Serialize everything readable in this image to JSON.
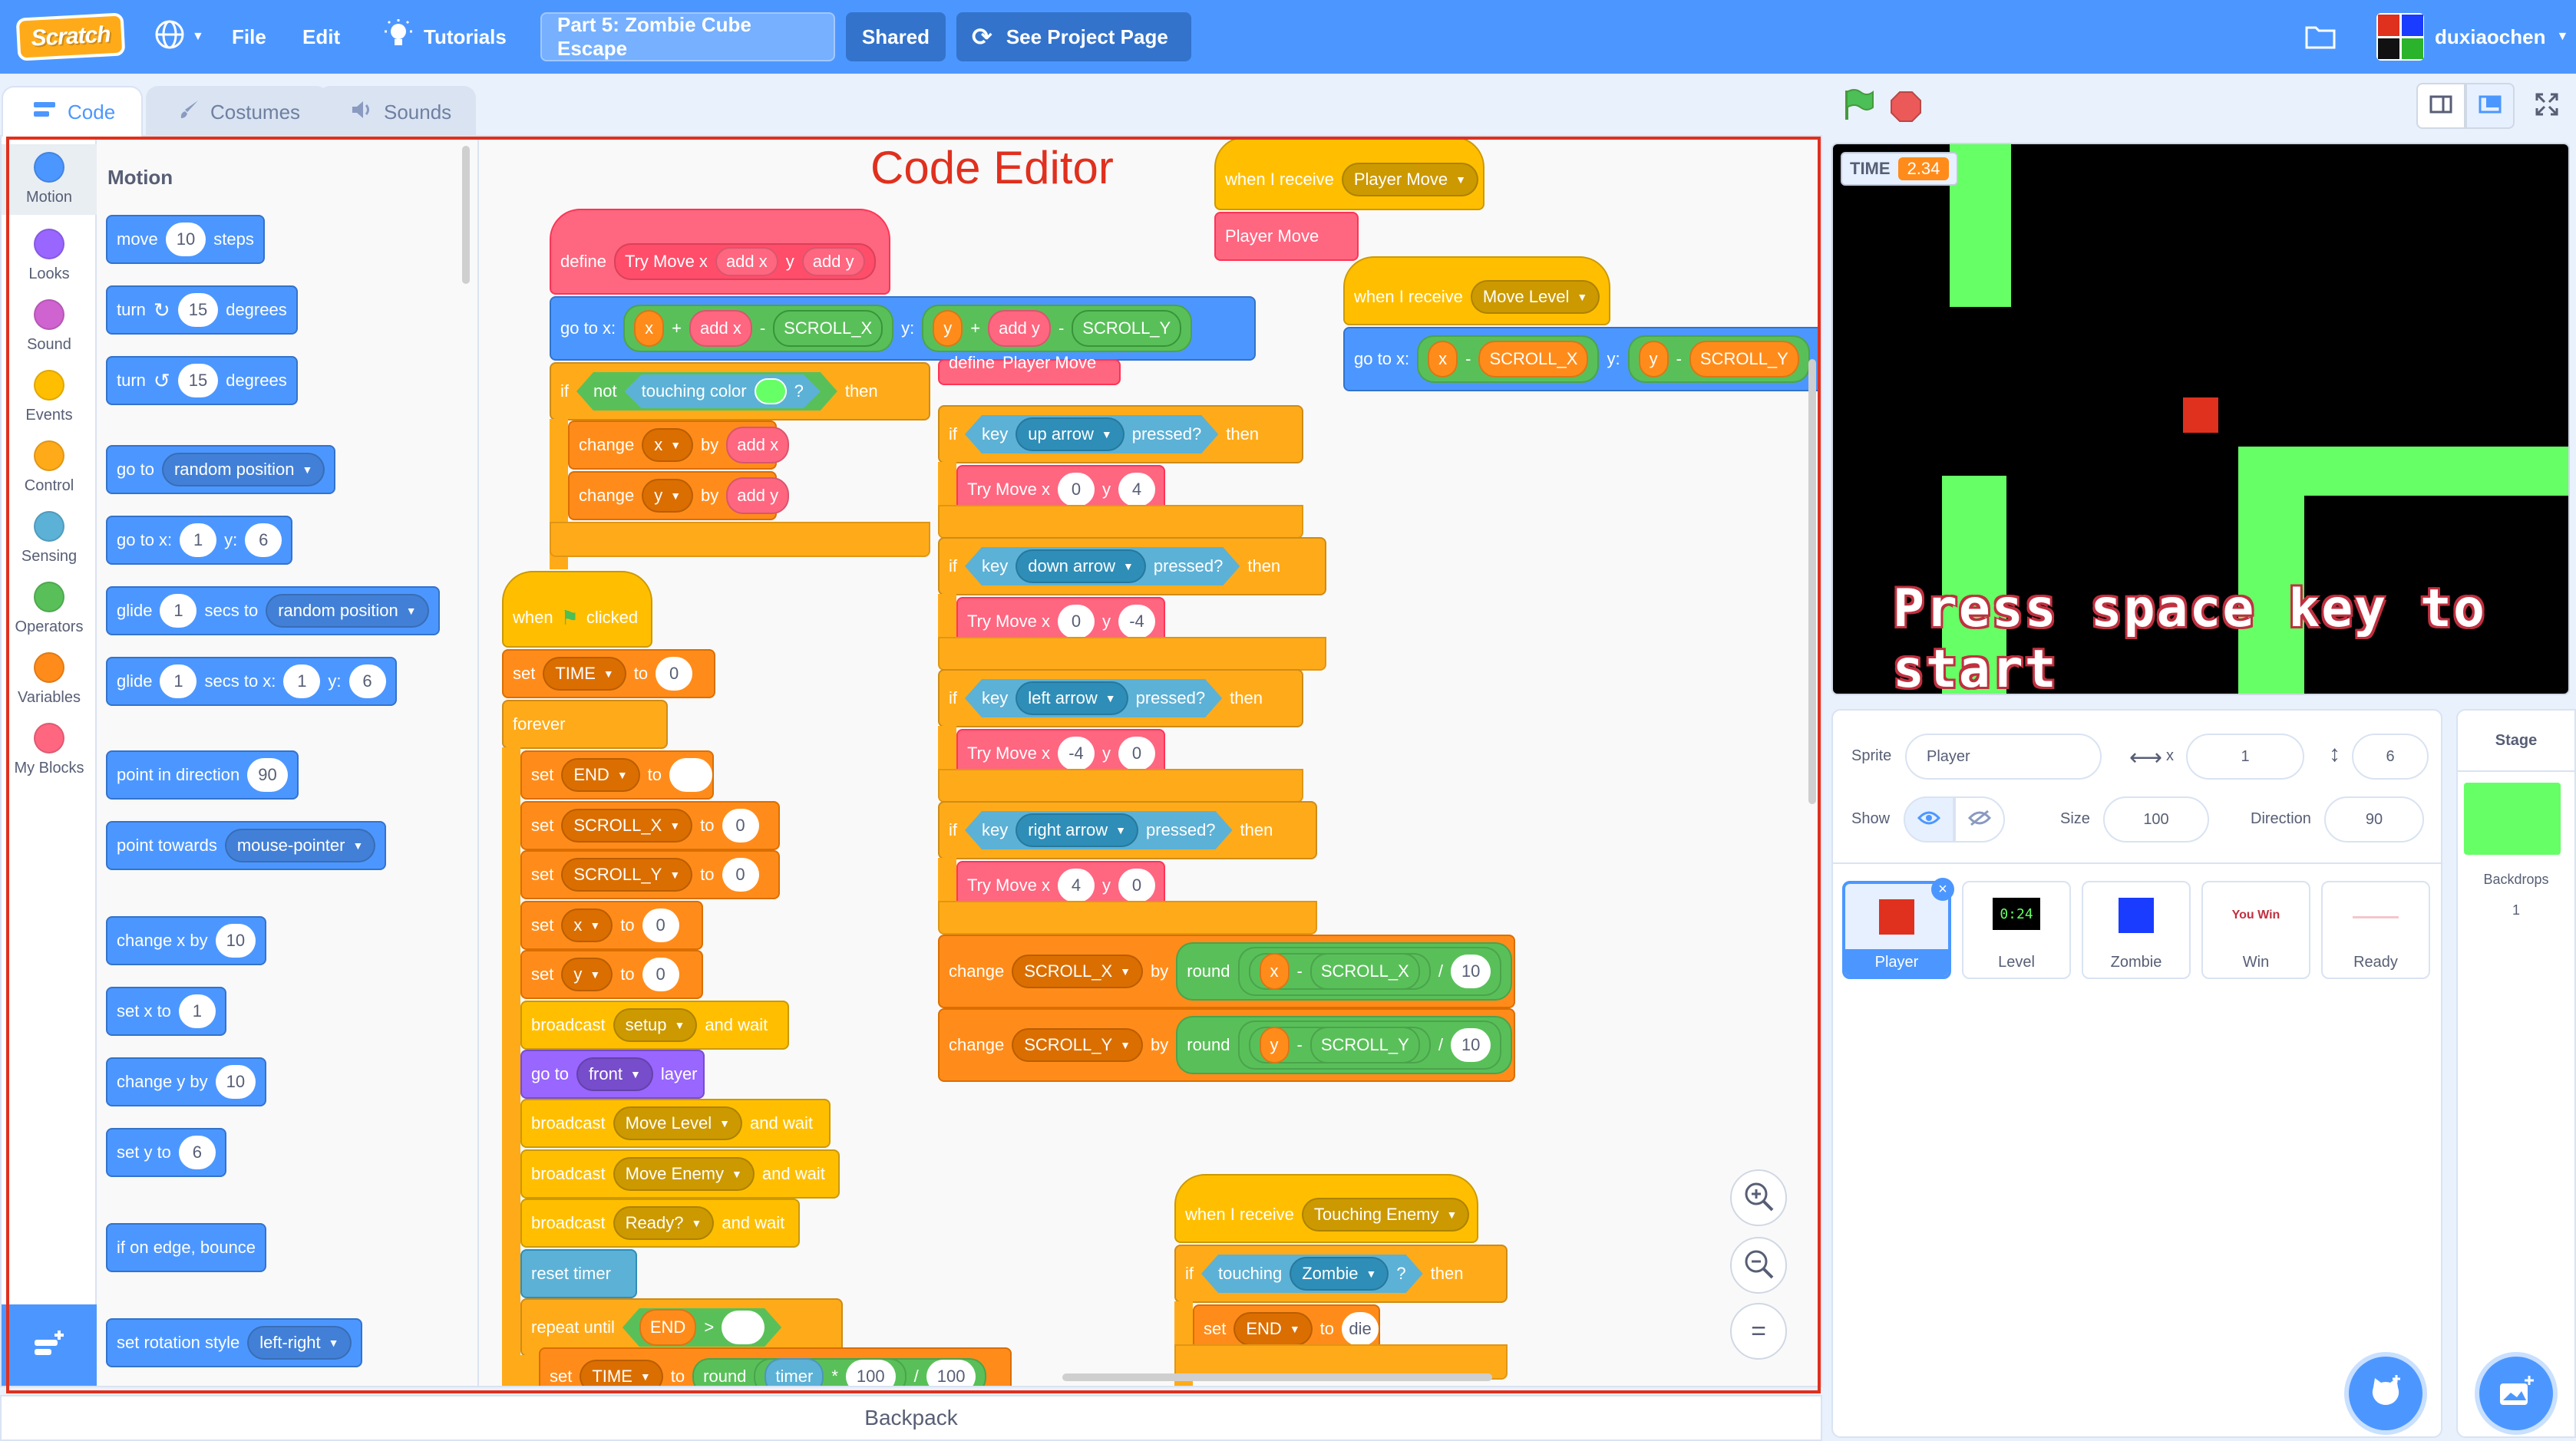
{
  "menubar": {
    "logo": "Scratch",
    "file": "File",
    "edit": "Edit",
    "tutorials": "Tutorials",
    "project_title": "Part 5: Zombie Cube Escape",
    "shared": "Shared",
    "see_project": "See Project Page",
    "username": "duxiaochen"
  },
  "tabs": {
    "code": "Code",
    "costumes": "Costumes",
    "sounds": "Sounds"
  },
  "categories": [
    "Motion",
    "Looks",
    "Sound",
    "Events",
    "Control",
    "Sensing",
    "Operators",
    "Variables",
    "My Blocks"
  ],
  "category_colors": [
    "#4c97ff",
    "#9966ff",
    "#cf63cf",
    "#ffbf00",
    "#ffab19",
    "#5cb1d6",
    "#59c059",
    "#ff8c1a",
    "#ff6680"
  ],
  "palette": {
    "title": "Motion",
    "move": [
      "move",
      "10",
      "steps"
    ],
    "turn_right": [
      "turn",
      "15",
      "degrees"
    ],
    "turn_left": [
      "turn",
      "15",
      "degrees"
    ],
    "goto": [
      "go to",
      "random position"
    ],
    "goto_xy": [
      "go to x:",
      "1",
      "y:",
      "6"
    ],
    "glide": [
      "glide",
      "1",
      "secs to",
      "random position"
    ],
    "glide_xy": [
      "glide",
      "1",
      "secs to x:",
      "1",
      "y:",
      "6"
    ],
    "point_dir": [
      "point in direction",
      "90"
    ],
    "point_towards": [
      "point towards",
      "mouse-pointer"
    ],
    "change_x": [
      "change x by",
      "10"
    ],
    "set_x": [
      "set x to",
      "1"
    ],
    "change_y": [
      "change y by",
      "10"
    ],
    "set_y": [
      "set y to",
      "6"
    ],
    "bounce": "if on edge, bounce",
    "rotation": [
      "set rotation style",
      "left-right"
    ]
  },
  "annotation": "Code Editor",
  "scripts": {
    "define": {
      "define": "define",
      "name": "Try Move x",
      "a1": "add x",
      "y": "y",
      "a2": "add y",
      "goto": "go to x:",
      "x": "x",
      "plus": "+",
      "addx": "add x",
      "minus": "-",
      "scx": "SCROLL_X",
      "ylabel": "y:",
      "yv": "y",
      "addy": "add y",
      "scy": "SCROLL_Y",
      "if": "if",
      "not": "not",
      "touching_color": "touching color",
      "q": "?",
      "then": "then",
      "change": "change",
      "xvar": "x",
      "by": "by",
      "yvar": "y"
    },
    "flag": {
      "when": "when",
      "clicked": "clicked",
      "set": "set",
      "time": "TIME",
      "to": "to",
      "zero": "0",
      "forever": "forever",
      "end": "END",
      "scroll_x": "SCROLL_X",
      "scroll_y": "SCROLL_Y",
      "x": "x",
      "y": "y",
      "broadcast": "broadcast",
      "setup": "setup",
      "and_wait": "and wait",
      "goto": "go to",
      "front": "front",
      "layer": "layer",
      "move_level": "Move Level",
      "move_enemy": "Move Enemy",
      "ready": "Ready?",
      "reset_timer": "reset timer",
      "repeat_until": "repeat until",
      "gt": ">",
      "round": "round",
      "timer": "timer",
      "times": "*",
      "hundred": "100",
      "div": "/"
    },
    "player_move": {
      "when_receive": "when I receive",
      "msg": "Player Move",
      "call": "Player Move",
      "define": "define",
      "if": "if",
      "key": "key",
      "pressed": "pressed?",
      "then": "then",
      "up": "up arrow",
      "down": "down arrow",
      "left": "left arrow",
      "right": "right arrow",
      "try": "Try Move x",
      "y": "y",
      "v_up": [
        "0",
        "4"
      ],
      "v_down": [
        "0",
        "-4"
      ],
      "v_left": [
        "-4",
        "0"
      ],
      "v_right": [
        "4",
        "0"
      ],
      "change": "change",
      "scroll_x": "SCROLL_X",
      "scroll_y": "SCROLL_Y",
      "by": "by",
      "round": "round",
      "x": "x",
      "yvar": "y",
      "minus": "-",
      "div": "/",
      "ten": "10"
    },
    "move_level": {
      "when_receive": "when I receive",
      "msg": "Move Level",
      "goto": "go to x:",
      "x": "x",
      "minus": "-",
      "scx": "SCROLL_X",
      "ylabel": "y:",
      "y": "y",
      "scy": "SCROLL_Y"
    },
    "touching_enemy": {
      "when_receive": "when I receive",
      "msg": "Touching Enemy",
      "if": "if",
      "touching": "touching",
      "zombie": "Zombie",
      "q": "?",
      "then": "then",
      "set": "set",
      "end": "END",
      "to": "to",
      "die": "die"
    }
  },
  "backpack": "Backpack",
  "stage": {
    "monitor_label": "TIME",
    "monitor_value": "2.34",
    "message": "Press space key to start"
  },
  "sprite_info": {
    "sprite_label": "Sprite",
    "sprite_name": "Player",
    "x_label": "x",
    "x": "1",
    "y_label": "y",
    "y": "6",
    "show_label": "Show",
    "size_label": "Size",
    "size": "100",
    "direction_label": "Direction",
    "direction": "90"
  },
  "sprites": [
    "Player",
    "Level",
    "Zombie",
    "Win",
    "Ready"
  ],
  "sprite_thumbs": {
    "level": "0:24",
    "win": "You Win"
  },
  "stage_pane": {
    "title": "Stage",
    "backdrops_label": "Backdrops",
    "backdrops_count": "1"
  }
}
